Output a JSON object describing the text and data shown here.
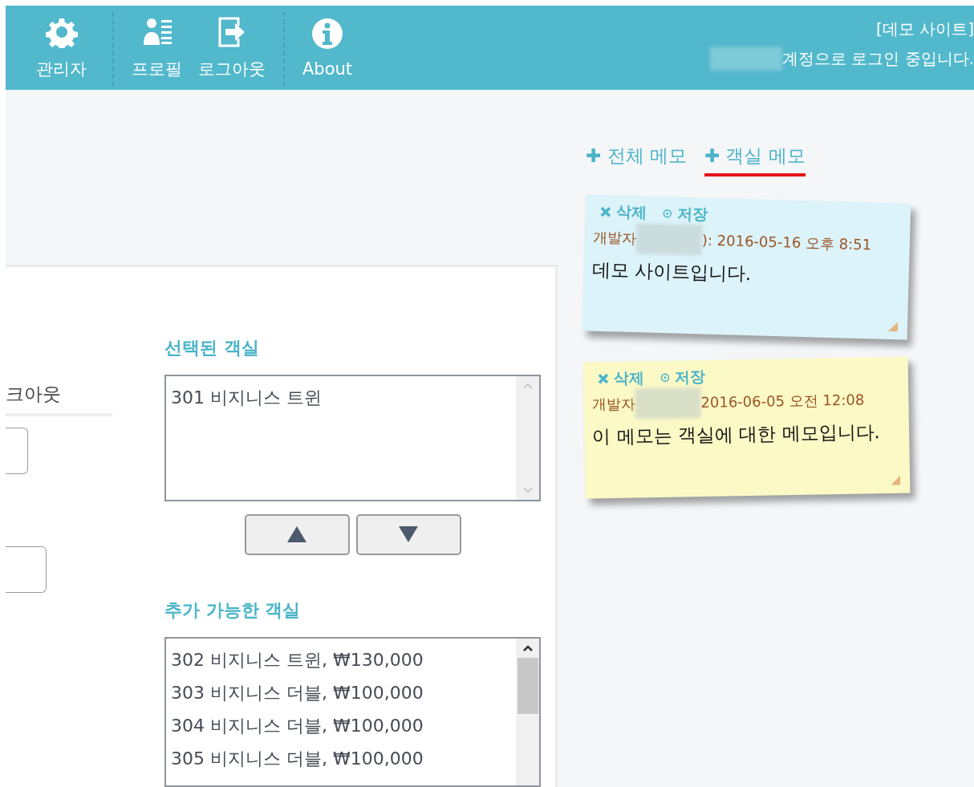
{
  "nav": {
    "items": [
      {
        "label": "관리자",
        "kind": "gear",
        "separator_before": false
      },
      {
        "label": "프로필",
        "kind": "profile",
        "separator_before": true
      },
      {
        "label": "로그아웃",
        "kind": "logout",
        "separator_before": false
      },
      {
        "label": "About",
        "kind": "info",
        "separator_before": true
      }
    ],
    "site": "[데모 사이트]",
    "login_text": "계정으로 로그인 중입니다."
  },
  "memo_tabs": [
    {
      "label": "전체 메모",
      "icon": "✚",
      "selected": false
    },
    {
      "label": "객실 메모",
      "icon": "✚",
      "selected": true
    }
  ],
  "memos": [
    {
      "color": "#dcf3f9",
      "delete": "삭제",
      "save": "저장",
      "author": "개발자",
      "meta": "): 2016-05-16 오후 8:51",
      "text": "데모 사이트입니다."
    },
    {
      "color": "#fbf9c6",
      "delete": "삭제",
      "save": "저장",
      "author": "개발자",
      "meta": "2016-06-05 오전 12:08",
      "text": "이 메모는 객실에 대한 메모입니다."
    }
  ],
  "form": {
    "left_label": "크아웃",
    "selected_rooms": {
      "title": "선택된 객실",
      "items": [
        "301 비지니스 트윈"
      ]
    },
    "move_buttons": [
      {
        "kind": "up"
      },
      {
        "kind": "down"
      }
    ],
    "available_rooms": {
      "title": "추가 가능한 객실",
      "items": [
        "302 비지니스 트윈, ₩130,000",
        "303 비지니스 더블, ₩100,000",
        "304 비지니스 더블, ₩100,000",
        "305 비지니스 더블, ₩100,000"
      ]
    }
  }
}
